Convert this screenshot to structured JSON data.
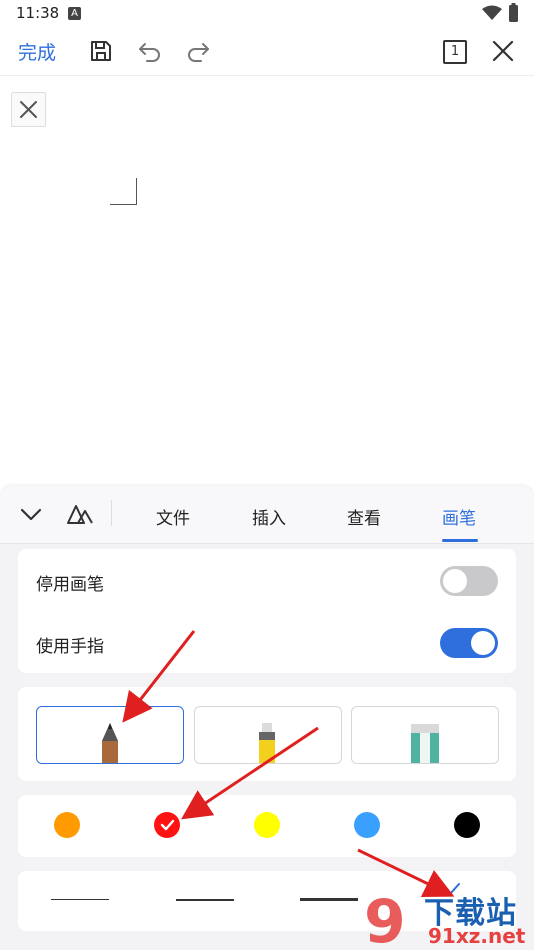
{
  "status_bar": {
    "time": "11:38",
    "notification_icon": "a-letter-icon",
    "wifi_icon": "wifi-icon",
    "battery_icon": "battery-icon"
  },
  "toolbar": {
    "done_label": "完成",
    "page_count": "1"
  },
  "tabs": [
    {
      "label": "文件"
    },
    {
      "label": "插入"
    },
    {
      "label": "查看"
    },
    {
      "label": "画笔",
      "active": true
    }
  ],
  "settings": {
    "disable_pen": {
      "label": "停用画笔",
      "on": false
    },
    "use_finger": {
      "label": "使用手指",
      "on": true
    }
  },
  "pen_types": [
    {
      "name": "pencil",
      "selected": true
    },
    {
      "name": "highlighter",
      "selected": false
    },
    {
      "name": "eraser",
      "selected": false
    }
  ],
  "colors": [
    {
      "hex": "#ff9a00",
      "selected": false
    },
    {
      "hex": "#ff1212",
      "selected": true
    },
    {
      "hex": "#ffff00",
      "selected": false
    },
    {
      "hex": "#3aa0ff",
      "selected": false
    },
    {
      "hex": "#000000",
      "selected": false
    }
  ],
  "thickness": {
    "options": [
      "thin",
      "medium",
      "thick"
    ],
    "selected": 3
  },
  "accent": "#2f6fdd",
  "watermark": {
    "text": "下载站",
    "url": "91xz.net"
  }
}
